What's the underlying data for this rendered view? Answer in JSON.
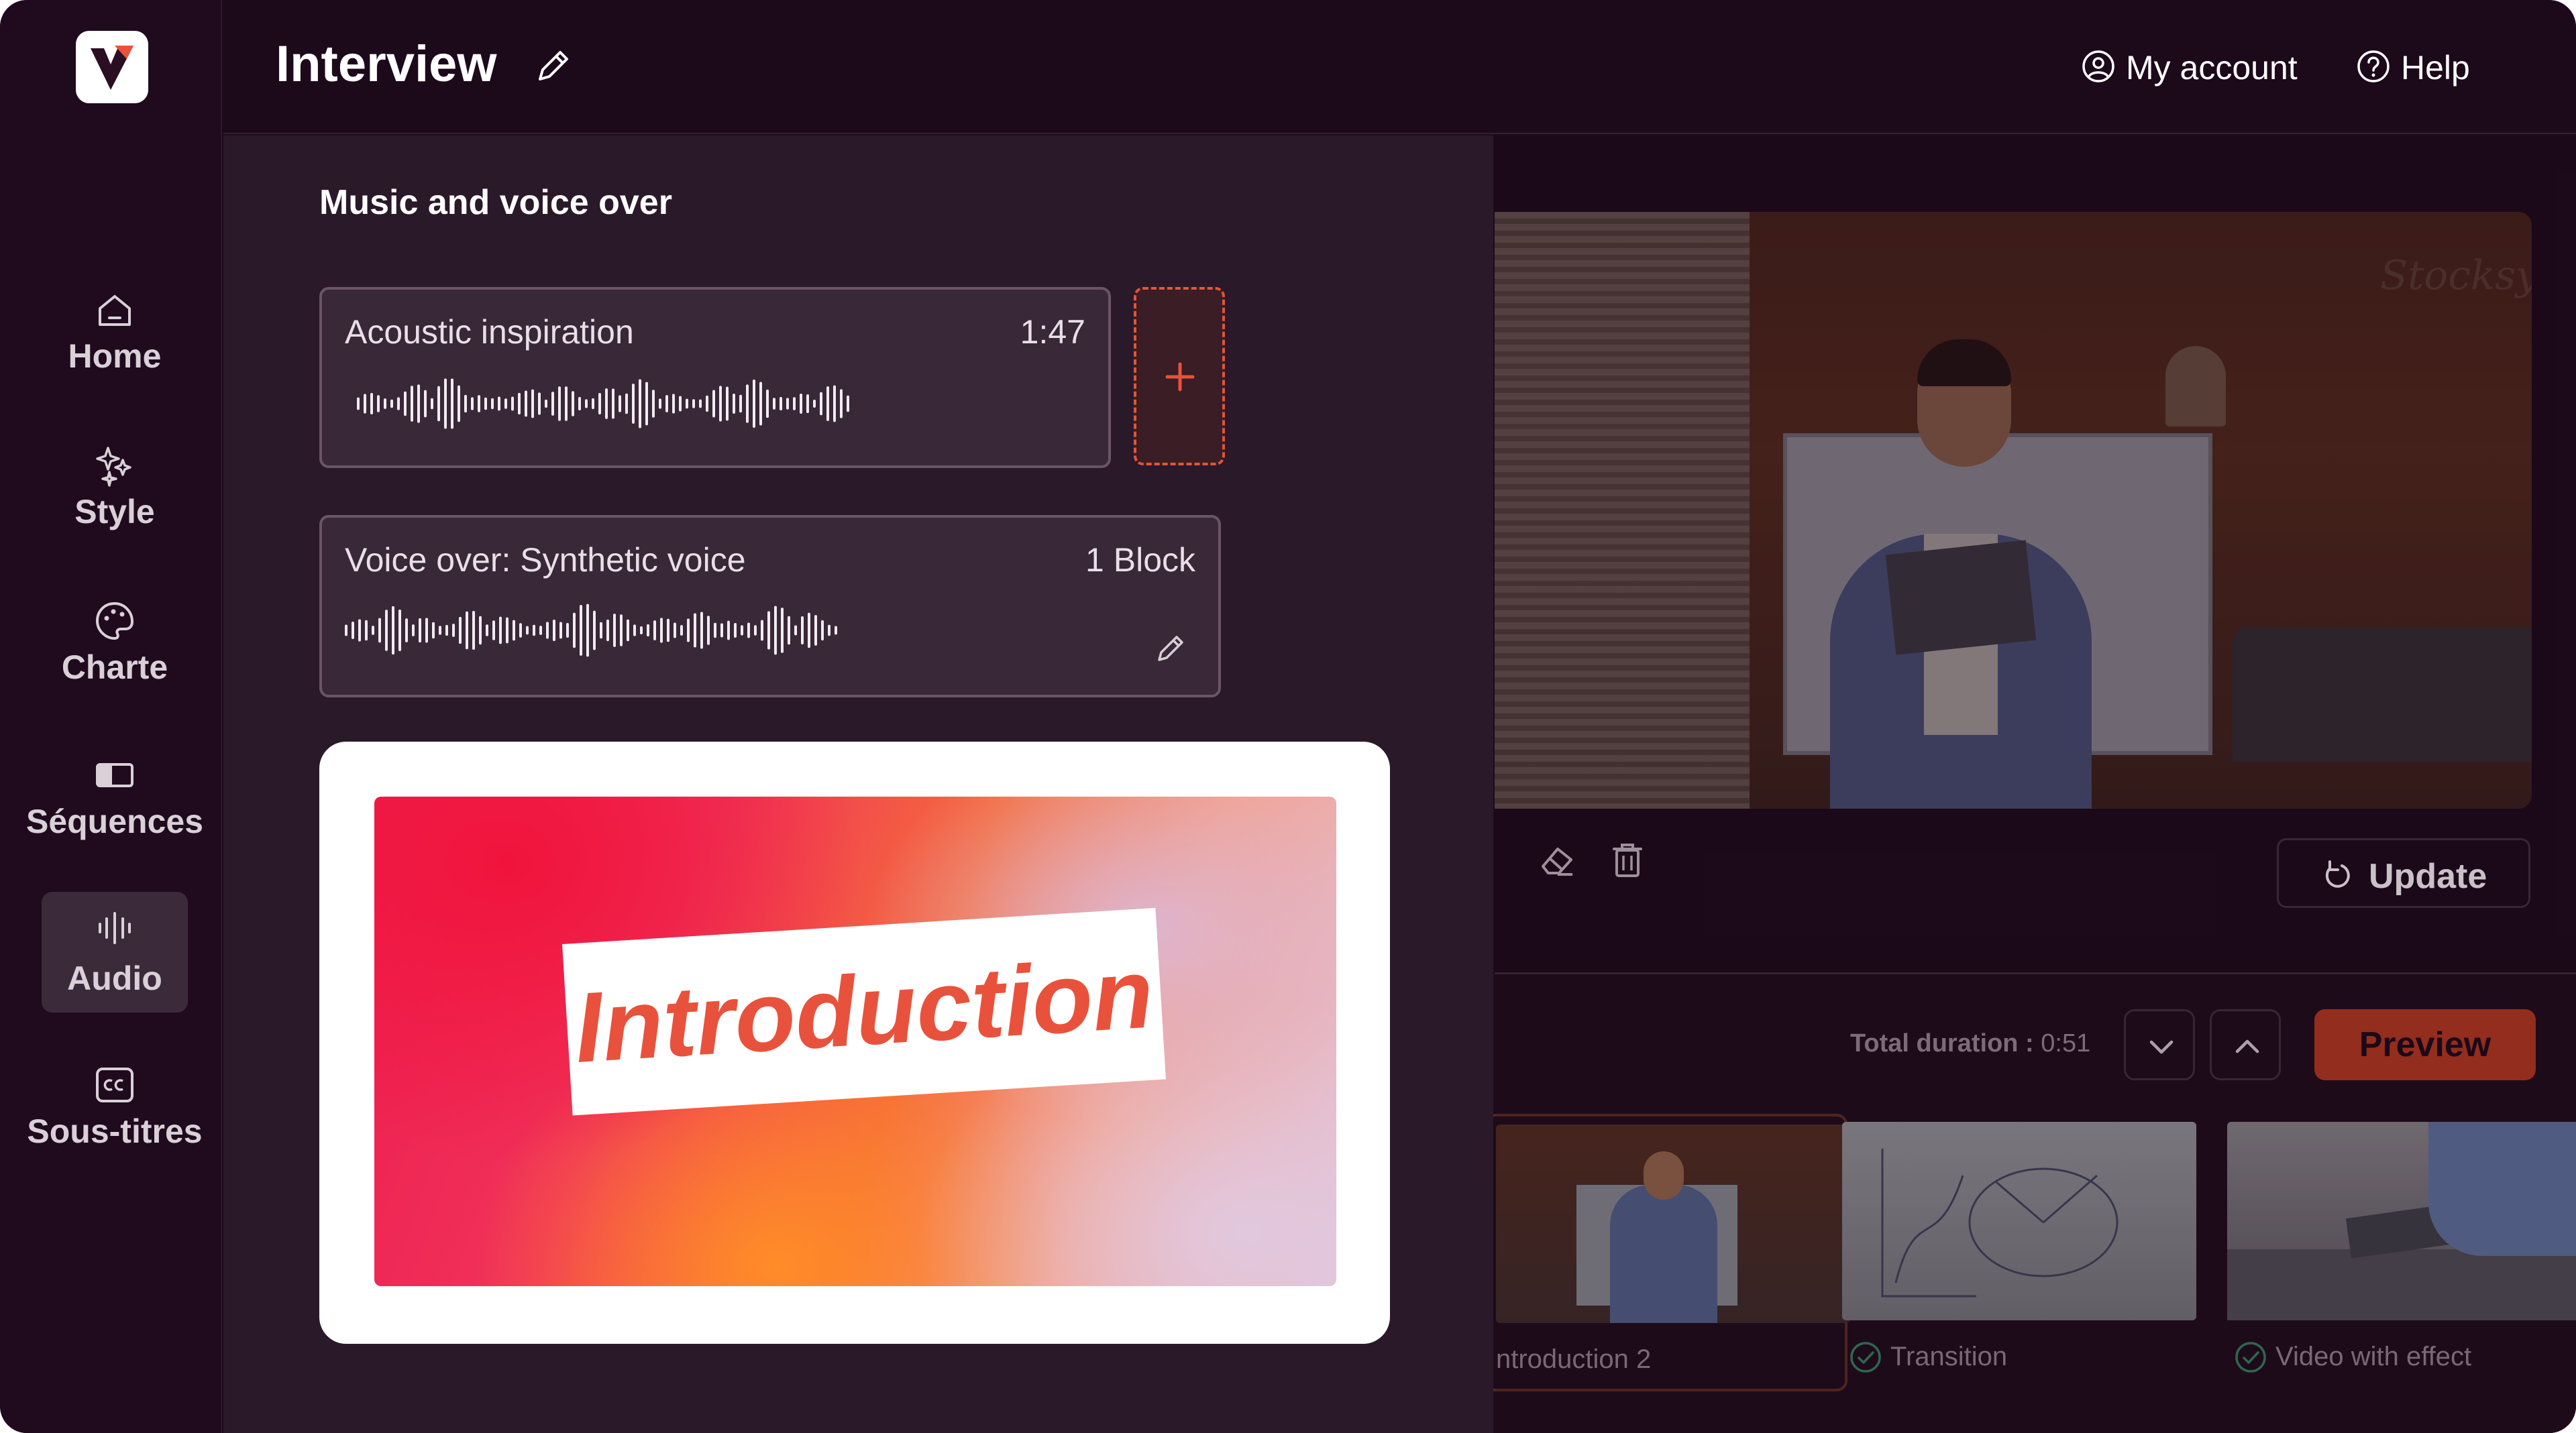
{
  "header": {
    "title": "Interview",
    "account_label": "My account",
    "help_label": "Help"
  },
  "sidebar": {
    "items": [
      {
        "label": "Home",
        "icon": "home-icon"
      },
      {
        "label": "Style",
        "icon": "sparkles-icon"
      },
      {
        "label": "Charte",
        "icon": "palette-icon"
      },
      {
        "label": "Séquences",
        "icon": "sequences-icon"
      },
      {
        "label": "Audio",
        "icon": "audio-icon",
        "active": true
      },
      {
        "label": "Sous-titres",
        "icon": "closed-captions-icon"
      }
    ]
  },
  "audio_panel": {
    "title": "Music and voice over",
    "music": {
      "name": "Acoustic inspiration",
      "duration": "1:47"
    },
    "voice_over": {
      "name": "Voice over: Synthetic voice",
      "blocks": "1 Block"
    },
    "intro_card": {
      "label": "Introduction"
    }
  },
  "preview": {
    "watermark": "Stocksy",
    "update_label": "Update"
  },
  "timeline": {
    "total_label": "Total duration :",
    "total_value": "0:51",
    "preview_label": "Preview",
    "clips": [
      {
        "name": "ntroduction 2"
      },
      {
        "name": "Transition"
      },
      {
        "name": "Video with effect"
      }
    ]
  },
  "colors": {
    "background": "#1c0a1a",
    "panel": "#2a1928",
    "accent": "#e2553a",
    "preview_button": "#a8341f"
  }
}
